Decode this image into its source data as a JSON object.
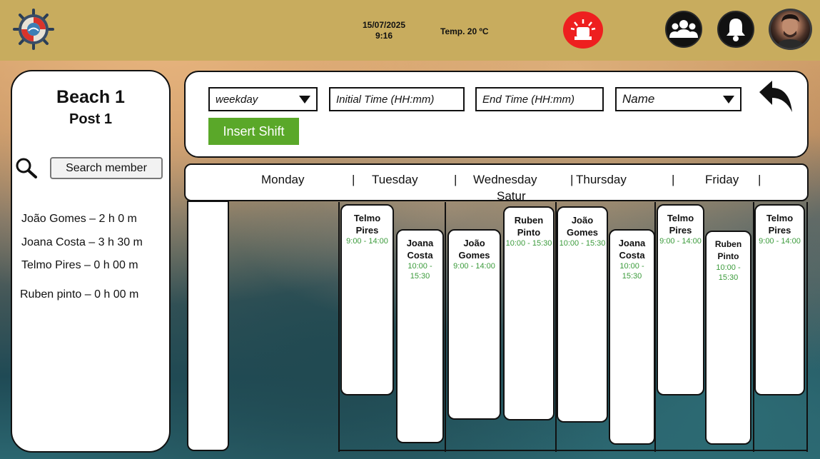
{
  "header": {
    "date": "15/07/2025",
    "time": "9:16",
    "temperature": "Temp. 20 ºC",
    "icons": [
      "lifebuoy-logo-icon",
      "alarm-siren-icon",
      "team-icon",
      "bell-icon",
      "user-avatar"
    ],
    "colors": {
      "bar": "#c8ac5e",
      "alarm": "#ee1f1f"
    }
  },
  "sidebar": {
    "beach": "Beach 1",
    "post": "Post 1",
    "search_label": "Search member",
    "members": [
      "João Gomes – 2 h 0 m",
      "Joana Costa – 3 h 30 m",
      "Telmo Pires – 0 h 00 m",
      "Ruben pinto – 0 h 00 m"
    ]
  },
  "form": {
    "weekday_placeholder": "weekday",
    "initial_time_placeholder": "Initial Time (HH:mm)",
    "end_time_placeholder": "End Time (HH:mm)",
    "name_placeholder": "Name",
    "insert_label": "Insert Shift",
    "insert_color": "#5aa829"
  },
  "days": {
    "monday": "Monday",
    "sep1": "|",
    "tuesday": "Tuesday",
    "sep2": "|",
    "wednesday": "Wednesday",
    "sep3": "|",
    "thursday": "Thursday",
    "sep4": "|",
    "friday": "Friday",
    "sep5": "|",
    "saturday": "Satur"
  },
  "shifts": [
    {
      "name": "Telmo Pires",
      "time": "9:00 - 14:00"
    },
    {
      "name": "Joana Costa",
      "time": "10:00 - 15:30"
    },
    {
      "name": "João Gomes",
      "time": "9:00 - 14:00"
    },
    {
      "name": "Ruben Pinto",
      "time": "10:00 - 15:30"
    },
    {
      "name": "João Gomes",
      "time": "10:00 - 15:30"
    },
    {
      "name": "Joana Costa",
      "time": "10:00 - 15:30"
    },
    {
      "name": "Telmo Pires",
      "time": "9:00 - 14:00"
    },
    {
      "name": "Ruben Pinto",
      "time": "10:00 - 15:30"
    },
    {
      "name": "Telmo Pires",
      "time": "9:00 - 14:00"
    }
  ]
}
